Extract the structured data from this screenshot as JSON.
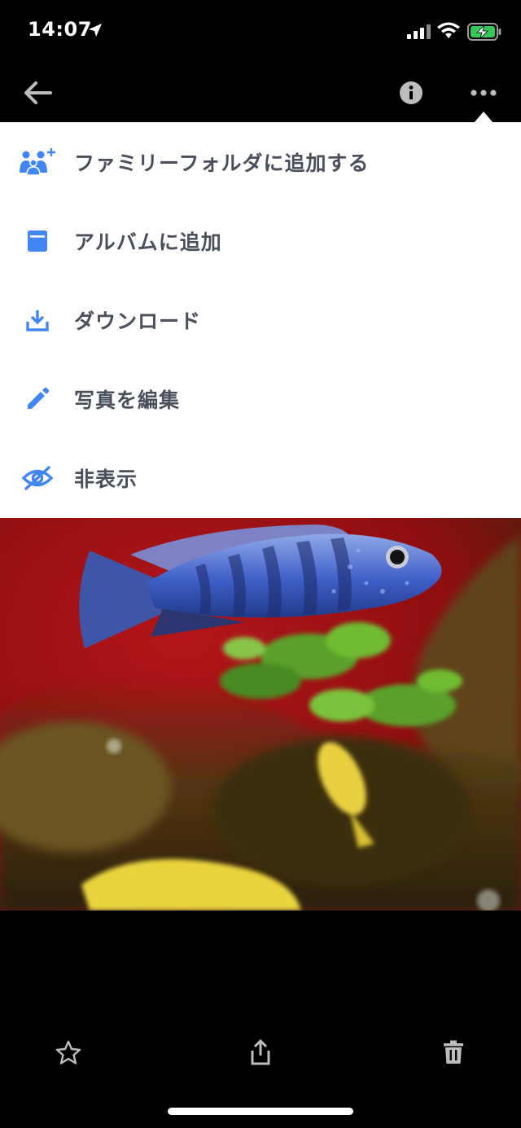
{
  "status_bar": {
    "time": "14:07"
  },
  "top_bar": {
    "back_icon": "arrow-left-icon",
    "info_icon": "info-icon",
    "more_icon": "more-horizontal-icon"
  },
  "menu": {
    "accent_color": "#4285f4",
    "label_color": "#4a4f5c",
    "items": [
      {
        "label": "ファミリーフォルダに追加する",
        "icon": "family-add-icon"
      },
      {
        "label": "アルバムに追加",
        "icon": "album-icon"
      },
      {
        "label": "ダウンロード",
        "icon": "download-icon"
      },
      {
        "label": "写真を編集",
        "icon": "pencil-icon"
      },
      {
        "label": "非表示",
        "icon": "eye-off-icon"
      }
    ]
  },
  "photo": {
    "subject": "aquarium-fish-photo"
  },
  "bottom_bar": {
    "favorite_icon": "star-icon",
    "share_icon": "share-icon",
    "delete_icon": "trash-icon"
  }
}
